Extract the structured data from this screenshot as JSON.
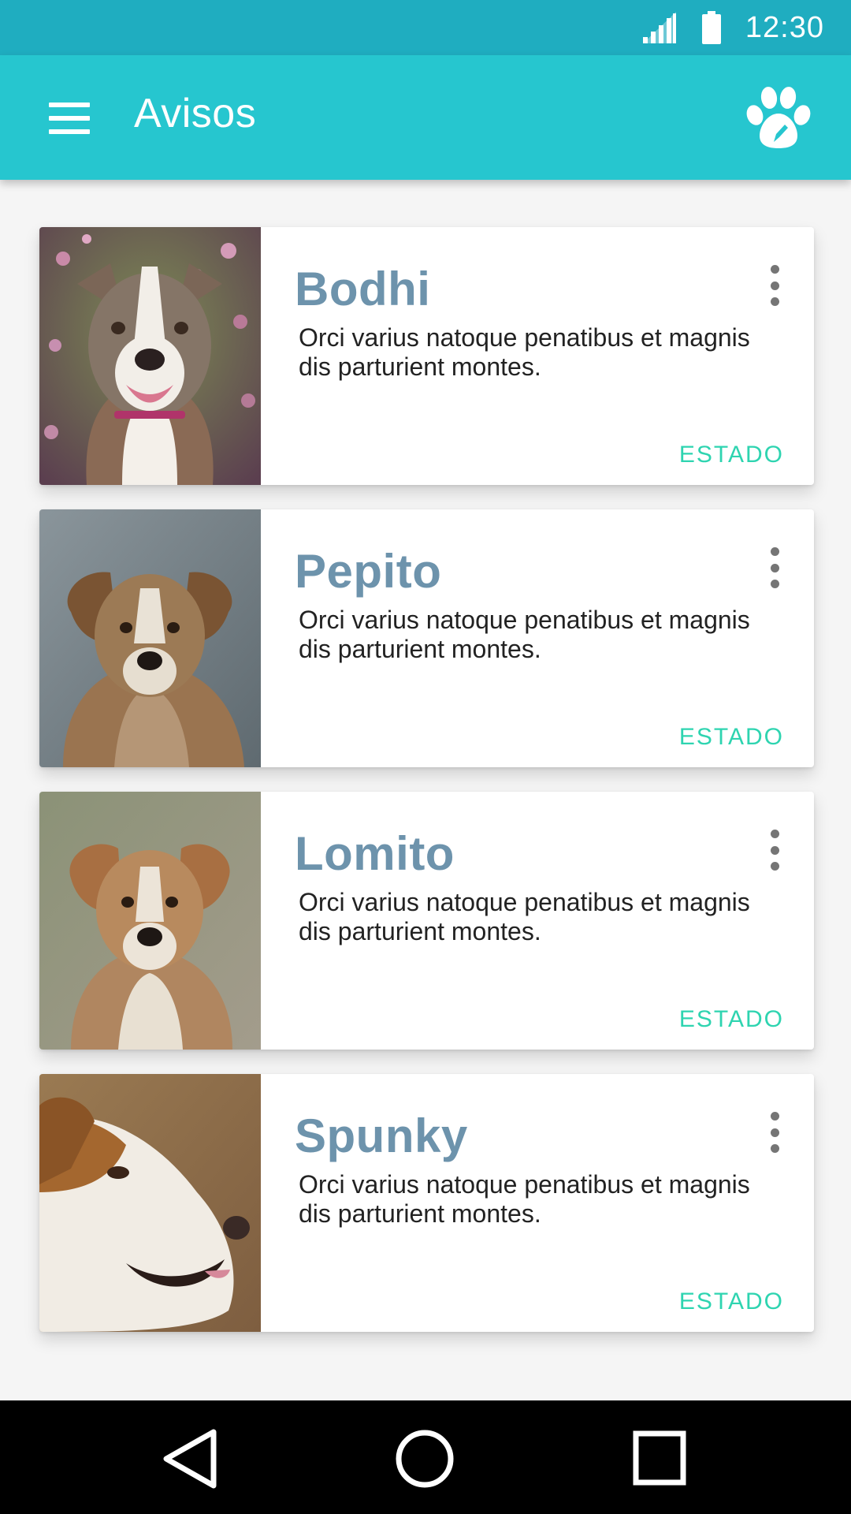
{
  "status_bar": {
    "time": "12:30",
    "icons": [
      "signal-icon",
      "battery-icon"
    ]
  },
  "app_bar": {
    "title": "Avisos",
    "menu_icon": "hamburger-menu-icon",
    "action_icon": "paw-icon"
  },
  "cards": [
    {
      "name": "Bodhi",
      "description": "Orci varius natoque penatibus et magnis dis parturient montes.",
      "status": "ESTADO",
      "image": "dog-photo-bodhi"
    },
    {
      "name": "Pepito",
      "description": "Orci varius natoque penatibus et magnis dis parturient montes.",
      "status": "ESTADO",
      "image": "dog-photo-pepito"
    },
    {
      "name": "Lomito",
      "description": "Orci varius natoque penatibus et magnis dis parturient montes.",
      "status": "ESTADO",
      "image": "dog-photo-lomito"
    },
    {
      "name": "Spunky",
      "description": "Orci varius natoque penatibus et magnis dis parturient montes.",
      "status": "ESTADO",
      "image": "dog-photo-spunky"
    }
  ],
  "nav_bar": {
    "buttons": [
      "back-icon",
      "home-icon",
      "recents-icon"
    ]
  },
  "colors": {
    "status_bar": "#1fadc0",
    "app_bar": "#26c6cf",
    "card_title": "#6d93ac",
    "status_text": "#2ed4b0",
    "background": "#f5f5f5"
  }
}
